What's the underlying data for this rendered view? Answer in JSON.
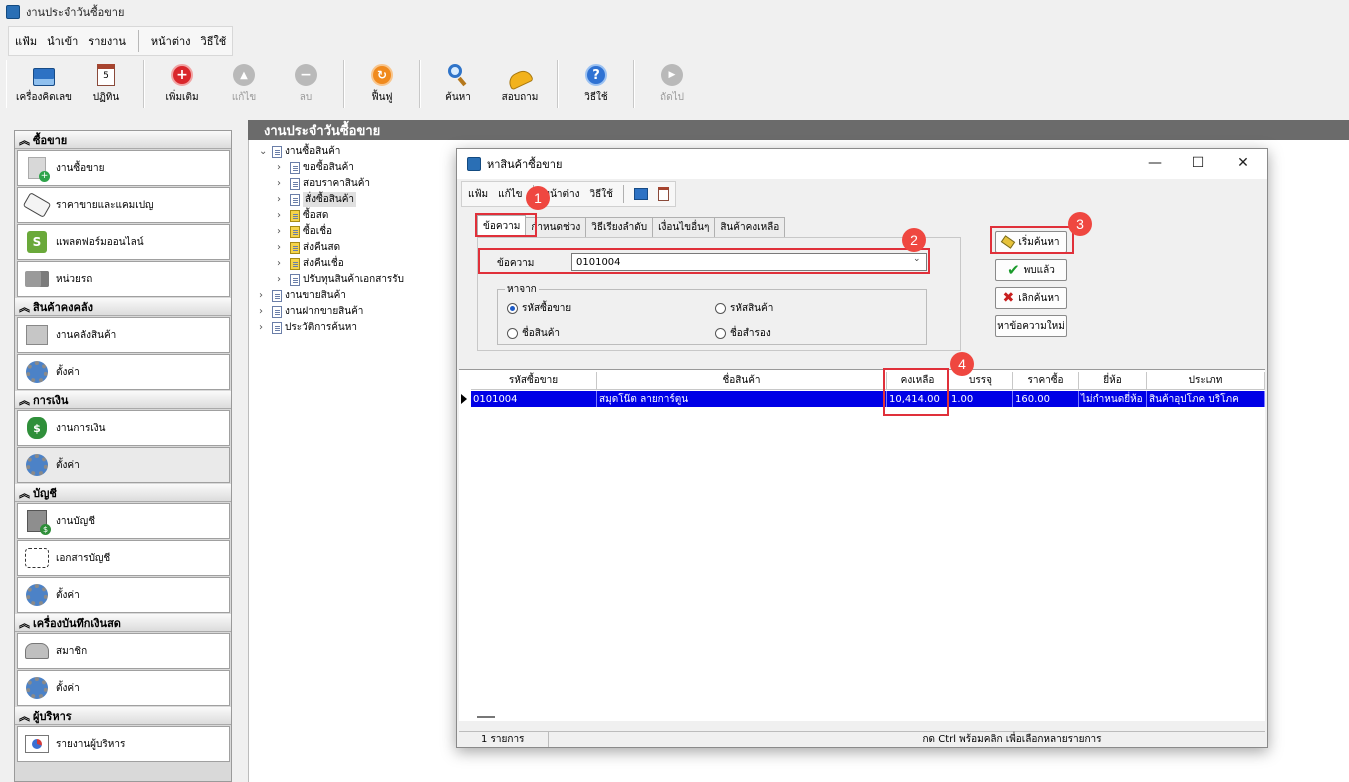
{
  "app": {
    "title": "งานประจำวันซื้อขาย"
  },
  "menu": [
    "แฟ้ม",
    "นำเข้า",
    "รายงาน",
    "หน้าต่าง",
    "วิธีใช้"
  ],
  "toolbar": {
    "calculator": "เครื่องคิดเลข",
    "calendar": "ปฏิทิน",
    "add": "เพิ่มเติม",
    "edit": "แก้ไข",
    "delete": "ลบ",
    "restore": "ฟื้นฟู",
    "search": "ค้นหา",
    "inquiry": "สอบถาม",
    "help": "วิธีใช้",
    "next": "ถัดไป"
  },
  "sidebar": {
    "sections": [
      {
        "title": "ซื้อขาย",
        "items": [
          "งานซื้อขาย",
          "ราคาขายและแคมเปญ",
          "แพลตฟอร์มออนไลน์",
          "หน่วยรถ"
        ]
      },
      {
        "title": "สินค้าคงคลัง",
        "items": [
          "งานคลังสินค้า",
          "ตั้งค่า"
        ]
      },
      {
        "title": "การเงิน",
        "items": [
          "งานการเงิน",
          "ตั้งค่า"
        ]
      },
      {
        "title": "บัญชี",
        "items": [
          "งานบัญชี",
          "เอกสารบัญชี",
          "ตั้งค่า"
        ]
      },
      {
        "title": "เครื่องบันทึกเงินสด",
        "items": [
          "สมาชิก",
          "ตั้งค่า"
        ]
      },
      {
        "title": "ผู้บริหาร",
        "items": [
          "รายงานผู้บริหาร"
        ]
      }
    ]
  },
  "main": {
    "title": "งานประจำวันซื้อขาย"
  },
  "tree": {
    "root": "งานซื้อสินค้า",
    "children": [
      "ขอซื้อสินค้า",
      "สอบราคาสินค้า",
      "สั่งซื้อสินค้า",
      "ซื้อสด",
      "ซื้อเชื่อ",
      "ส่งคืนสด",
      "ส่งคืนเชื่อ",
      "ปรับทุนสินค้าเอกสารรับ"
    ],
    "others": [
      "งานขายสินค้า",
      "งานฝากขายสินค้า",
      "ประวัติการค้นหา"
    ]
  },
  "dialog": {
    "title": "หาสินค้าซื้อขาย",
    "menu": [
      "แฟ้ม",
      "แก้ไข",
      "หน้าต่าง",
      "วิธีใช้"
    ],
    "tabs": [
      "ข้อความ",
      "กำหนดช่วง",
      "วิธีเรียงลำดับ",
      "เงื่อนไขอื่นๆ",
      "สินค้าคงเหลือ"
    ],
    "keyword_label": "ข้อความ",
    "keyword_value": "0101004",
    "search_from": "หาจาก",
    "radios": [
      "รหัสซื้อขาย",
      "รหัสสินค้า",
      "ชื่อสินค้า",
      "ชื่อสำรอง"
    ],
    "buttons": {
      "start": "เริ่มค้นหา",
      "found": "พบแล้ว",
      "cancel": "เลิกค้นหา",
      "new": "หาข้อความใหม่"
    },
    "columns": [
      "รหัสซื้อขาย",
      "ชื่อสินค้า",
      "คงเหลือ",
      "บรรจุ",
      "ราคาซื้อ",
      "ยี่ห้อ",
      "ประเภท"
    ],
    "rows": [
      [
        "0101004",
        "สมุดโน๊ต ลายการ์ตูน",
        "10,414.00",
        "1.00",
        "160.00",
        "ไม่กำหนดยี่ห้อ",
        "สินค้าอุปโภค บริโภค"
      ]
    ],
    "status_count": "1 รายการ",
    "status_hint": "กด Ctrl พร้อมคลิก เพื่อเลือกหลายรายการ"
  },
  "callouts": [
    "1",
    "2",
    "3",
    "4"
  ],
  "colors": {
    "selection": "#0000e6",
    "callout": "#e0303a",
    "header": "#6b6b6b"
  }
}
